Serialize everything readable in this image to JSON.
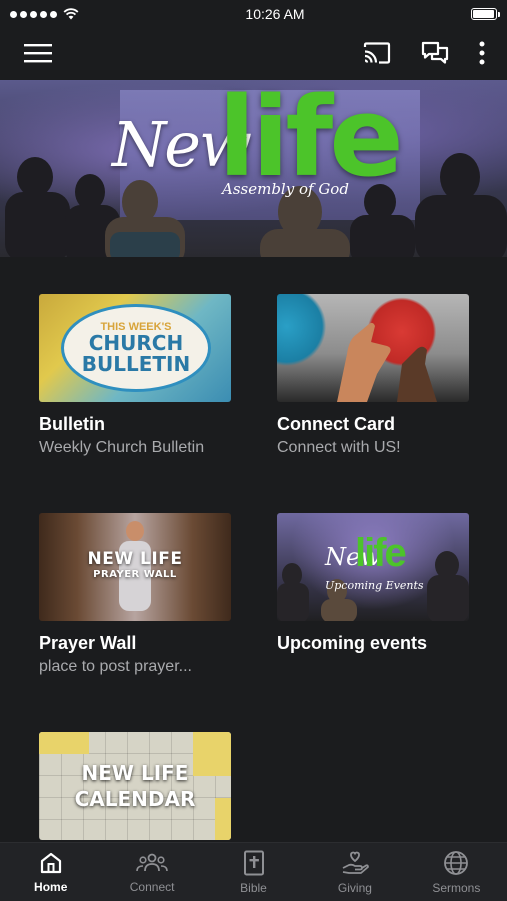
{
  "status_bar": {
    "time": "10:26 AM",
    "signal_icon": "signal-dots-icon",
    "wifi_icon": "wifi-icon",
    "battery_icon": "battery-icon",
    "battery_level": 0.95
  },
  "app_bar": {
    "menu_icon": "hamburger-menu-icon",
    "cast_icon": "cast-icon",
    "chat_icon": "chat-bubbles-icon",
    "more_icon": "more-vertical-icon"
  },
  "hero": {
    "logo_new": "New",
    "logo_life": "life",
    "logo_sub": "Assembly of God"
  },
  "cards": [
    {
      "title": "Bulletin",
      "subtitle": "Weekly Church Bulletin",
      "thumb_lines": [
        "THIS WEEK'S",
        "CHURCH",
        "BULLETIN"
      ]
    },
    {
      "title": "Connect Card",
      "subtitle": "Connect with US!"
    },
    {
      "title": "Prayer Wall",
      "subtitle": "place to post prayer...",
      "thumb_lines": [
        "NEW LIFE",
        "PRAYER WALL"
      ]
    },
    {
      "title": "Upcoming events",
      "subtitle": "",
      "thumb_lines": [
        "New",
        "life",
        "Upcoming Events"
      ]
    },
    {
      "title": "",
      "subtitle": "",
      "thumb_lines": [
        "NEW LIFE",
        "CALENDAR"
      ]
    }
  ],
  "tabs": [
    {
      "label": "Home",
      "icon": "home-icon",
      "active": true
    },
    {
      "label": "Connect",
      "icon": "people-icon",
      "active": false
    },
    {
      "label": "Bible",
      "icon": "bible-icon",
      "active": false
    },
    {
      "label": "Giving",
      "icon": "giving-hand-icon",
      "active": false
    },
    {
      "label": "Sermons",
      "icon": "globe-icon",
      "active": false
    }
  ],
  "colors": {
    "background": "#1b1c1e",
    "tab_bar": "#222326",
    "brand_green": "#4cc42a",
    "subtitle_gray": "#a9aaad"
  }
}
